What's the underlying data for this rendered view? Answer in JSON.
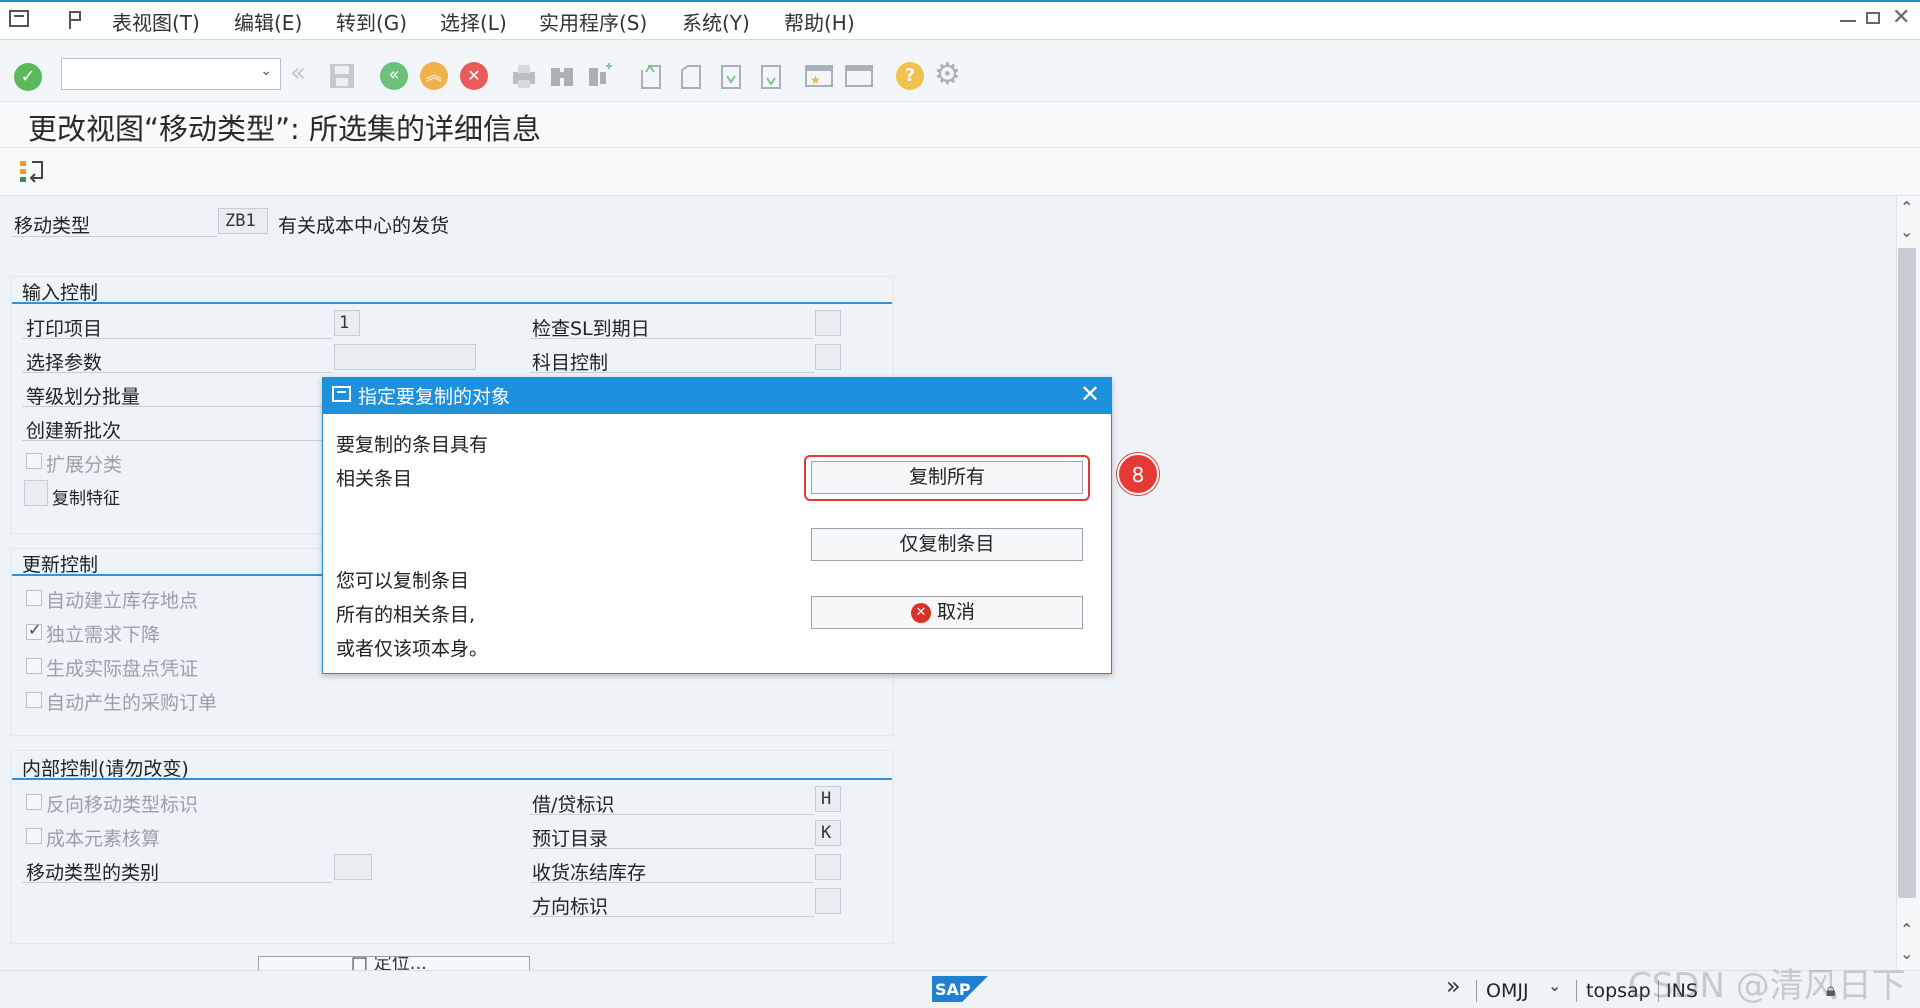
{
  "menu": {
    "items": [
      {
        "label": "表视图(T)"
      },
      {
        "label": "编辑(E)"
      },
      {
        "label": "转到(G)"
      },
      {
        "label": "选择(L)"
      },
      {
        "label": "实用程序(S)"
      },
      {
        "label": "系统(Y)"
      },
      {
        "label": "帮助(H)"
      }
    ]
  },
  "page": {
    "title": "更改视图“移动类型”: 所选集的详细信息"
  },
  "header_fields": {
    "movement_type_label": "移动类型",
    "movement_type_value": "ZB1",
    "movement_type_desc": "有关成本中心的发货"
  },
  "input_control": {
    "title": "输入控制",
    "print_item_label": "打印项目",
    "print_item_value": "1",
    "check_sl_label": "检查SL到期日",
    "select_param_label": "选择参数",
    "account_control_label": "科目控制",
    "batch_class_label": "等级划分批量",
    "create_batch_label": "创建新批次",
    "extend_class_label": "扩展分类",
    "copy_char_label": "复制特征"
  },
  "update_control": {
    "title": "更新控制",
    "auto_storage_label": "自动建立库存地点",
    "indep_req_label": "独立需求下降",
    "phys_inv_label": "生成实际盘点凭证",
    "auto_po_label": "自动产生的采购订单"
  },
  "internal_control": {
    "title": "内部控制(请勿改变)",
    "reverse_mt_label": "反向移动类型标识",
    "cost_elem_label": "成本元素核算",
    "mt_category_label": "移动类型的类别",
    "debit_credit_label": "借/贷标识",
    "debit_credit_value": "H",
    "booking_dir_label": "预订目录",
    "booking_dir_value": "K",
    "gr_blocked_label": "收货冻结库存",
    "direction_label": "方向标识"
  },
  "bottom_button": {
    "label": "□ 定位..."
  },
  "dialog": {
    "title": "指定要复制的对象",
    "text_line1": "要复制的条目具有",
    "text_line2": "相关条目",
    "text_line3": "您可以复制条目",
    "text_line4": "所有的相关条目,",
    "text_line5": "或者仅该项本身。",
    "btn_copy_all": "复制所有",
    "btn_copy_entry": "仅复制条目",
    "btn_cancel": "取消"
  },
  "annotation": {
    "step": "8"
  },
  "status": {
    "tcode": "OMJJ",
    "server": "topsap",
    "mode": "INS",
    "watermark": "CSDN @清风日下"
  },
  "colors": {
    "accent": "#1e91dc",
    "highlight": "#e53935"
  }
}
